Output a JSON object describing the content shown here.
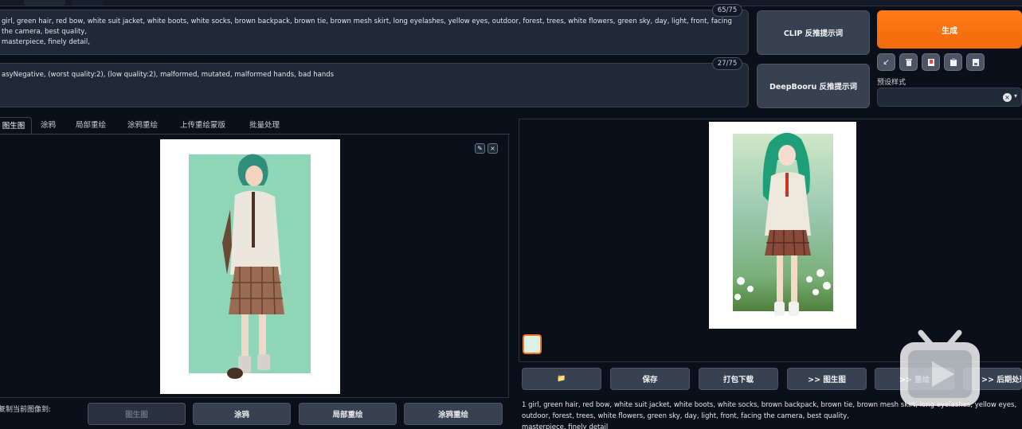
{
  "prompt": {
    "positive_text": "girl, green hair, red bow, white suit jacket, white boots, white socks, brown backpack, brown tie, brown mesh skirt, long eyelashes, yellow eyes, outdoor, forest, trees, white flowers, green sky, day, light, front, facing the camera, best quality,\nmasterpiece, finely detail,",
    "positive_counter": "65/75",
    "negative_text": "asyNegative, (worst quality:2), (low quality:2), malformed, mutated, malformed hands, bad hands",
    "negative_counter": "27/75"
  },
  "buttons": {
    "clip": "CLIP  反推提示词",
    "deepbooru": "DeepBooru 反推提示词",
    "generate": "生成"
  },
  "tool_icons": [
    "arrow-icon",
    "trash-icon",
    "bookmark-icon",
    "clipboard-icon",
    "save-style-icon"
  ],
  "style_label": "预设样式",
  "tabs": [
    "图生图",
    "涂鸦",
    "局部重绘",
    "涂鸦重绘",
    "上传重绘蒙版",
    "批量处理"
  ],
  "copy_label": "复制当前图像到:",
  "send_buttons": [
    "图生图",
    "涂鸦",
    "局部重绘",
    "涂鸦重绘"
  ],
  "output_actions": [
    "📁",
    "保存",
    "打包下载",
    ">> 图生图",
    ">> 重绘",
    ">> 后期处理"
  ],
  "caption": "1 girl, green hair, red bow, white suit jacket, white boots, white socks, brown backpack, brown tie, brown mesh skirt, long eyelashes, yellow eyes, outdoor, forest, trees, white flowers, green sky, day, light, front, facing the camera, best quality,\nmasterpiece, finely detail",
  "colors": {
    "accent": "#f97316",
    "panel": "#1f2937",
    "bg": "#0b0f19"
  }
}
